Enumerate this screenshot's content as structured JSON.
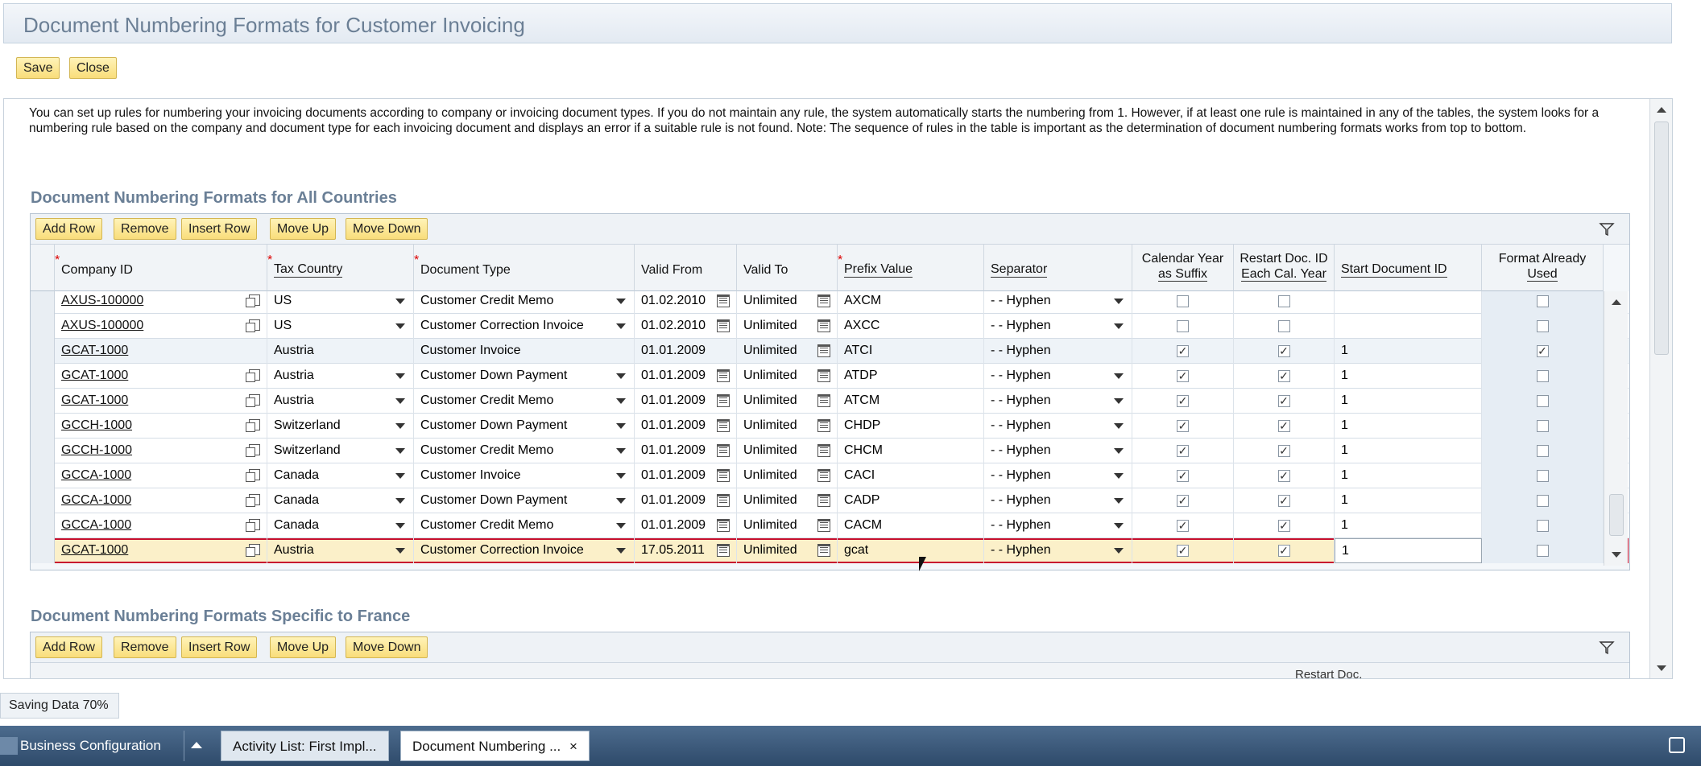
{
  "window": {
    "title": "Document Numbering Formats for Customer Invoicing"
  },
  "actions": {
    "save": "Save",
    "close": "Close"
  },
  "note": "You can set up rules for numbering your invoicing documents according to company or invoicing document types. If you do not maintain any rule, the system automatically starts the numbering from 1. However, if at least one rule is maintained in any of the tables, the system looks for a numbering rule based on the company and document type for each invoicing document and displays an error if a suitable rule is not found. Note: The sequence of rules in the table is important as the determination of document numbering formats works from top to bottom.",
  "section1": {
    "title": "Document Numbering Formats for All Countries",
    "toolbar": [
      "Add Row",
      "Remove",
      "Insert Row",
      "Move Up",
      "Move Down"
    ],
    "columns": {
      "company": "Company ID",
      "tax_country": "Tax Country",
      "doc_type": "Document Type",
      "valid_from": "Valid From",
      "valid_to": "Valid To",
      "prefix": "Prefix Value",
      "separator": "Separator",
      "cal_year_1": "Calendar Year",
      "cal_year_2": "as Suffix",
      "restart_1": "Restart Doc. ID",
      "restart_2": "Each Cal. Year",
      "start_id": "Start Document ID",
      "format_used_1": "Format Already",
      "format_used_2": "Used"
    },
    "rows": [
      {
        "company": "AXUS-100000",
        "country": "US",
        "doctype": "Customer Credit Memo",
        "from": "01.02.2010",
        "to": "Unlimited",
        "prefix": "AXCM",
        "sep": "- - Hyphen",
        "cal": false,
        "restart": false,
        "start": "",
        "used": false,
        "editable": true
      },
      {
        "company": "AXUS-100000",
        "country": "US",
        "doctype": "Customer Correction Invoice",
        "from": "01.02.2010",
        "to": "Unlimited",
        "prefix": "AXCC",
        "sep": "- - Hyphen",
        "cal": false,
        "restart": false,
        "start": "",
        "used": false,
        "editable": true
      },
      {
        "company": "GCAT-1000",
        "country": "Austria",
        "doctype": "Customer Invoice",
        "from": "01.01.2009",
        "to": "Unlimited",
        "prefix": "ATCI",
        "sep": "- - Hyphen",
        "cal": true,
        "restart": true,
        "start": "1",
        "used": true,
        "editable": false
      },
      {
        "company": "GCAT-1000",
        "country": "Austria",
        "doctype": "Customer Down Payment",
        "from": "01.01.2009",
        "to": "Unlimited",
        "prefix": "ATDP",
        "sep": "- - Hyphen",
        "cal": true,
        "restart": true,
        "start": "1",
        "used": false,
        "editable": true
      },
      {
        "company": "GCAT-1000",
        "country": "Austria",
        "doctype": "Customer Credit Memo",
        "from": "01.01.2009",
        "to": "Unlimited",
        "prefix": "ATCM",
        "sep": "- - Hyphen",
        "cal": true,
        "restart": true,
        "start": "1",
        "used": false,
        "editable": true
      },
      {
        "company": "GCCH-1000",
        "country": "Switzerland",
        "doctype": "Customer Down Payment",
        "from": "01.01.2009",
        "to": "Unlimited",
        "prefix": "CHDP",
        "sep": "- - Hyphen",
        "cal": true,
        "restart": true,
        "start": "1",
        "used": false,
        "editable": true
      },
      {
        "company": "GCCH-1000",
        "country": "Switzerland",
        "doctype": "Customer Credit Memo",
        "from": "01.01.2009",
        "to": "Unlimited",
        "prefix": "CHCM",
        "sep": "- - Hyphen",
        "cal": true,
        "restart": true,
        "start": "1",
        "used": false,
        "editable": true
      },
      {
        "company": "GCCA-1000",
        "country": "Canada",
        "doctype": "Customer Invoice",
        "from": "01.01.2009",
        "to": "Unlimited",
        "prefix": "CACI",
        "sep": "- - Hyphen",
        "cal": true,
        "restart": true,
        "start": "1",
        "used": false,
        "editable": true
      },
      {
        "company": "GCCA-1000",
        "country": "Canada",
        "doctype": "Customer Down Payment",
        "from": "01.01.2009",
        "to": "Unlimited",
        "prefix": "CADP",
        "sep": "- - Hyphen",
        "cal": true,
        "restart": true,
        "start": "1",
        "used": false,
        "editable": true
      },
      {
        "company": "GCCA-1000",
        "country": "Canada",
        "doctype": "Customer Credit Memo",
        "from": "01.01.2009",
        "to": "Unlimited",
        "prefix": "CACM",
        "sep": "- - Hyphen",
        "cal": true,
        "restart": true,
        "start": "1",
        "used": false,
        "editable": true
      },
      {
        "company": "GCAT-1000",
        "country": "Austria",
        "doctype": "Customer Correction Invoice",
        "from": "17.05.2011",
        "to": "Unlimited",
        "prefix": "gcat",
        "sep": "- - Hyphen",
        "cal": true,
        "restart": true,
        "start": "1",
        "used": false,
        "editable": true,
        "selected": true
      }
    ]
  },
  "section2": {
    "title": "Document Numbering Formats Specific to France",
    "toolbar": [
      "Add Row",
      "Remove",
      "Insert Row",
      "Move Up",
      "Move Down"
    ],
    "partial_header": "Restart Doc."
  },
  "status": {
    "text": "Saving Data 70%",
    "progress": 0.7
  },
  "taskbar": {
    "start": "Business Configuration",
    "tabs": [
      "Activity List: First Impl...",
      "Document Numbering ..."
    ],
    "close_glyph": "×"
  }
}
